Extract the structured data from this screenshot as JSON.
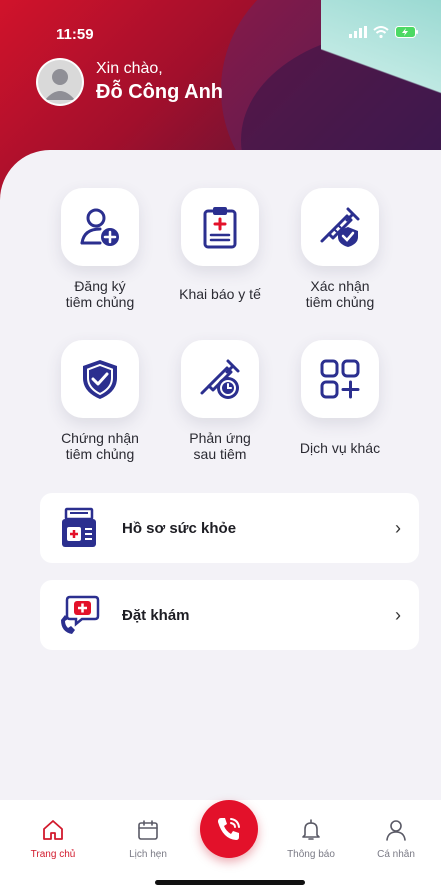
{
  "status_bar": {
    "time": "11:59"
  },
  "greeting": {
    "hello": "Xin chào,",
    "name": "Đỗ Công Anh"
  },
  "tiles": [
    {
      "label": "Đăng ký\ntiêm chủng",
      "icon": "user-add-icon"
    },
    {
      "label": "Khai báo y tế",
      "icon": "clipboard-medical-icon"
    },
    {
      "label": "Xác nhận\ntiêm chủng",
      "icon": "syringe-shield-icon"
    },
    {
      "label": "Chứng nhận\ntiêm chủng",
      "icon": "shield-check-icon"
    },
    {
      "label": "Phản ứng\nsau tiêm",
      "icon": "syringe-clock-icon"
    },
    {
      "label": "Dịch vụ khác",
      "icon": "grid-plus-icon"
    }
  ],
  "list": [
    {
      "title": "Hồ sơ sức khỏe",
      "icon": "health-record-icon"
    },
    {
      "title": "Đặt khám",
      "icon": "medical-chat-icon"
    }
  ],
  "bottom_nav": {
    "home": "Trang chủ",
    "schedule": "Lịch hẹn",
    "notifications": "Thông báo",
    "profile": "Cá nhân"
  },
  "colors": {
    "primary": "#e3112a",
    "accent": "#2b2f8f",
    "background": "#f3f2f7"
  }
}
